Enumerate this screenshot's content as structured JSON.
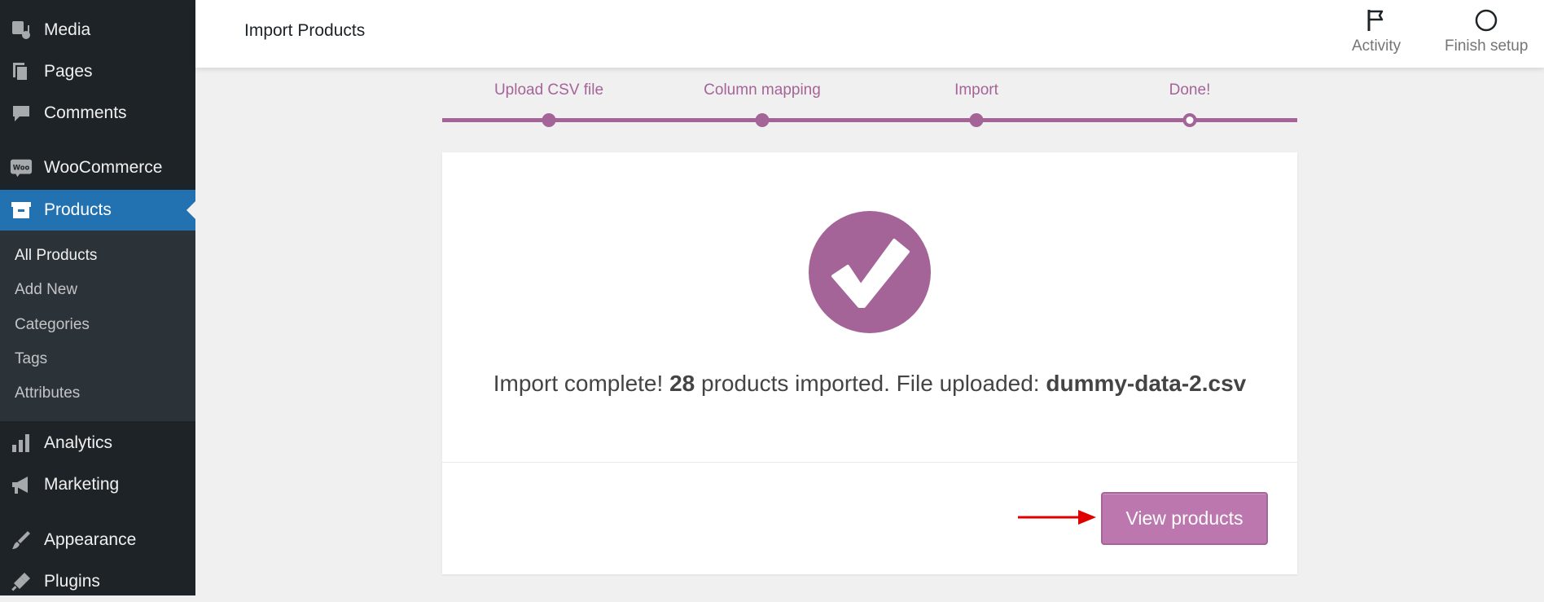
{
  "sidebar": {
    "top_items": [
      {
        "label": "Media",
        "icon": "media-icon"
      },
      {
        "label": "Pages",
        "icon": "pages-icon"
      },
      {
        "label": "Comments",
        "icon": "comments-icon"
      },
      {
        "label": "WooCommerce",
        "icon": "woocommerce-icon"
      },
      {
        "label": "Products",
        "icon": "products-icon"
      }
    ],
    "submenu": [
      "All Products",
      "Add New",
      "Categories",
      "Tags",
      "Attributes"
    ],
    "bottom_items": [
      {
        "label": "Analytics",
        "icon": "analytics-icon"
      },
      {
        "label": "Marketing",
        "icon": "megaphone-icon"
      },
      {
        "label": "Appearance",
        "icon": "brush-icon"
      },
      {
        "label": "Plugins",
        "icon": "plugin-icon"
      }
    ],
    "woo_badge": "Woo"
  },
  "header": {
    "title": "Import Products",
    "activity_label": "Activity",
    "finish_setup_label": "Finish setup"
  },
  "stepper": {
    "steps": [
      "Upload CSV file",
      "Column mapping",
      "Import",
      "Done!"
    ],
    "current_step": 4
  },
  "result": {
    "prefix": "Import complete!",
    "count": "28",
    "middle": "products imported. File uploaded:",
    "filename": "dummy-data-2.csv"
  },
  "actions": {
    "view_products_label": "View products"
  },
  "colors": {
    "accent": "#a46497",
    "button": "#bb77ae",
    "sidebar_bg": "#1d2327",
    "active_menu": "#2271b1",
    "arrow": "#e00000"
  }
}
